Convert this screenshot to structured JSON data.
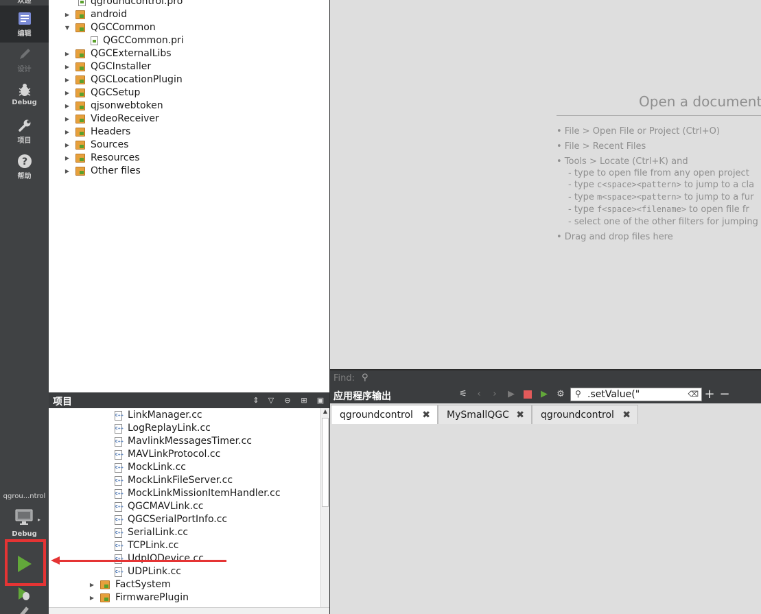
{
  "modebar": {
    "top_partial_label": "欢迎",
    "items": [
      {
        "label": "编辑",
        "icon": "edit-icon",
        "state": "active"
      },
      {
        "label": "设计",
        "icon": "design-icon",
        "state": "disabled"
      },
      {
        "label": "Debug",
        "icon": "debug-bug-icon",
        "state": "normal"
      },
      {
        "label": "项目",
        "icon": "wrench-icon",
        "state": "normal"
      },
      {
        "label": "帮助",
        "icon": "help-icon",
        "state": "normal"
      }
    ],
    "kit": {
      "name": "qgrou...ntrol",
      "mode": "Debug",
      "icon": "monitor-icon"
    },
    "run_button": {
      "icon": "play-icon"
    },
    "debug_run_button": {
      "icon": "debug-run-icon"
    }
  },
  "tree_top": {
    "rows": [
      {
        "label": "qgroundcontrol.pro",
        "type": "file",
        "expanded": null
      },
      {
        "label": "android",
        "type": "folder",
        "expanded": false
      },
      {
        "label": "QGCCommon",
        "type": "folder",
        "expanded": true
      },
      {
        "label": "QGCCommon.pri",
        "type": "file",
        "expanded": null
      },
      {
        "label": "QGCExternalLibs",
        "type": "folder",
        "expanded": false
      },
      {
        "label": "QGCInstaller",
        "type": "folder",
        "expanded": false
      },
      {
        "label": "QGCLocationPlugin",
        "type": "folder",
        "expanded": false
      },
      {
        "label": "QGCSetup",
        "type": "folder",
        "expanded": false
      },
      {
        "label": "qjsonwebtoken",
        "type": "folder",
        "expanded": false
      },
      {
        "label": "VideoReceiver",
        "type": "folder",
        "expanded": false
      },
      {
        "label": "Headers",
        "type": "folder",
        "expanded": false
      },
      {
        "label": "Sources",
        "type": "folder",
        "expanded": false
      },
      {
        "label": "Resources",
        "type": "folder",
        "expanded": false
      },
      {
        "label": "Other files",
        "type": "folder",
        "expanded": false
      }
    ]
  },
  "projects_pane": {
    "title": "项目",
    "buttons": [
      {
        "name": "sort-icon",
        "glyph": "⇕"
      },
      {
        "name": "filter-icon",
        "glyph": "▽"
      },
      {
        "name": "link-icon",
        "glyph": "⊖"
      },
      {
        "name": "split-icon",
        "glyph": "⊞"
      },
      {
        "name": "close-pane-icon",
        "glyph": "▣"
      }
    ]
  },
  "tree_bottom": {
    "files": [
      "LinkManager.cc",
      "LogReplayLink.cc",
      "MavlinkMessagesTimer.cc",
      "MAVLinkProtocol.cc",
      "MockLink.cc",
      "MockLinkFileServer.cc",
      "MockLinkMissionItemHandler.cc",
      "QGCMAVLink.cc",
      "QGCSerialPortInfo.cc",
      "SerialLink.cc",
      "TCPLink.cc",
      "UdpIODevice.cc",
      "UDPLink.cc"
    ],
    "file_icon_text": "C++",
    "folders": [
      "FactSystem",
      "FirmwarePlugin"
    ]
  },
  "editor": {
    "title": "Open a document",
    "hints": [
      {
        "text": "• File > Open File or Project (Ctrl+O)"
      },
      {
        "text": "• File > Recent Files"
      },
      {
        "text": "• Tools > Locate (Ctrl+K) and"
      },
      {
        "text": "- type to open file from any open project"
      },
      {
        "pre": "- type ",
        "code": "c<space><pattern>",
        "post": " to jump to a cla"
      },
      {
        "pre": "- type ",
        "code": "m<space><pattern>",
        "post": " to jump to a fur"
      },
      {
        "pre": "- type ",
        "code": "f<space><filename>",
        "post": " to open file fr"
      },
      {
        "text": "- select one of the other filters for jumping to"
      },
      {
        "text": "• Drag and drop files here"
      }
    ]
  },
  "findbar": {
    "label": "Find:",
    "icon": "search-icon"
  },
  "output": {
    "title": "应用程序输出",
    "filter_value": ".setValue(\"",
    "tabs": [
      {
        "label": "qgroundcontrol",
        "active": true
      },
      {
        "label": "MySmallQGC",
        "active": false
      },
      {
        "label": "qgroundcontrol",
        "active": false
      }
    ]
  },
  "annotation": {
    "highlight_color": "#e53434"
  }
}
